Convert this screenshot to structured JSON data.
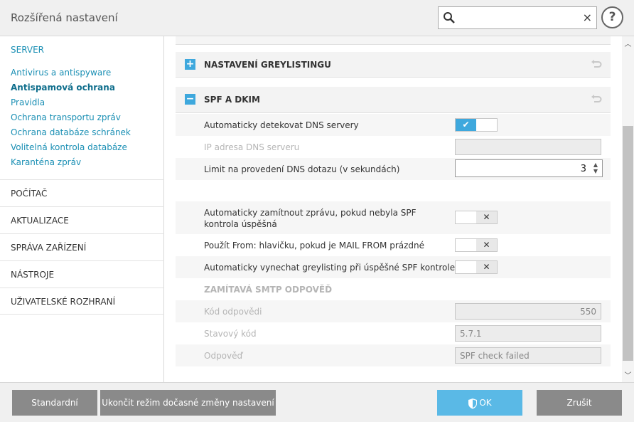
{
  "window": {
    "title": "Rozšířená nastavení"
  },
  "search": {
    "placeholder": "",
    "clear_label": "×"
  },
  "help_label": "?",
  "sidebar": {
    "section": "SERVER",
    "items": [
      {
        "label": "Antivirus a antispyware",
        "active": false
      },
      {
        "label": "Antispamová ochrana",
        "active": true
      },
      {
        "label": "Pravidla",
        "active": false
      },
      {
        "label": "Ochrana transportu zpráv",
        "active": false
      },
      {
        "label": "Ochrana databáze schránek",
        "active": false
      },
      {
        "label": "Volitelná kontrola databáze",
        "active": false
      },
      {
        "label": "Karanténa zpráv",
        "active": false
      }
    ],
    "categories": [
      "POČÍTAČ",
      "AKTUALIZACE",
      "SPRÁVA ZAŘÍZENÍ",
      "NÁSTROJE",
      "UŽIVATELSKÉ ROZHRANÍ"
    ]
  },
  "sections": {
    "greylisting": {
      "title": "NASTAVENÍ GREYLISTINGU",
      "toggle": "+"
    },
    "spf": {
      "title": "SPF A DKIM",
      "toggle": "−"
    }
  },
  "settings": {
    "auto_detect_dns": {
      "label": "Automaticky detekovat DNS servery",
      "on_glyph": "✔"
    },
    "dns_ip": {
      "label": "IP adresa DNS serveru",
      "value": ""
    },
    "dns_limit": {
      "label": "Limit na provedení DNS dotazu (v sekundách)",
      "value": "3"
    },
    "auto_reject": {
      "label": "Automaticky zamítnout zprávu, pokud nebyla SPF kontrola úspěšná",
      "off_glyph": "✕"
    },
    "use_from": {
      "label": "Použít From: hlavičku, pokud je MAIL FROM prázdné",
      "off_glyph": "✕"
    },
    "skip_greylisting": {
      "label": "Automaticky vynechat greylisting při úspěšné SPF kontrole",
      "off_glyph": "✕"
    },
    "smtp_header": "ZAMÍTAVÁ SMTP ODPOVĚĎ",
    "reply_code": {
      "label": "Kód odpovědi",
      "value": "550"
    },
    "status_code": {
      "label": "Stavový kód",
      "value": "5.7.1"
    },
    "reply": {
      "label": "Odpověď",
      "value": "SPF check failed"
    }
  },
  "footer": {
    "default_label": "Standardní",
    "end_temp_label": "Ukončit režim dočasné změny nastavení",
    "ok_label": "OK",
    "cancel_label": "Zrušit"
  },
  "colors": {
    "accent": "#3ea8dd",
    "link": "#1a8fb4",
    "button_gray": "#8a8a8a",
    "button_primary": "#5ab9e6"
  }
}
